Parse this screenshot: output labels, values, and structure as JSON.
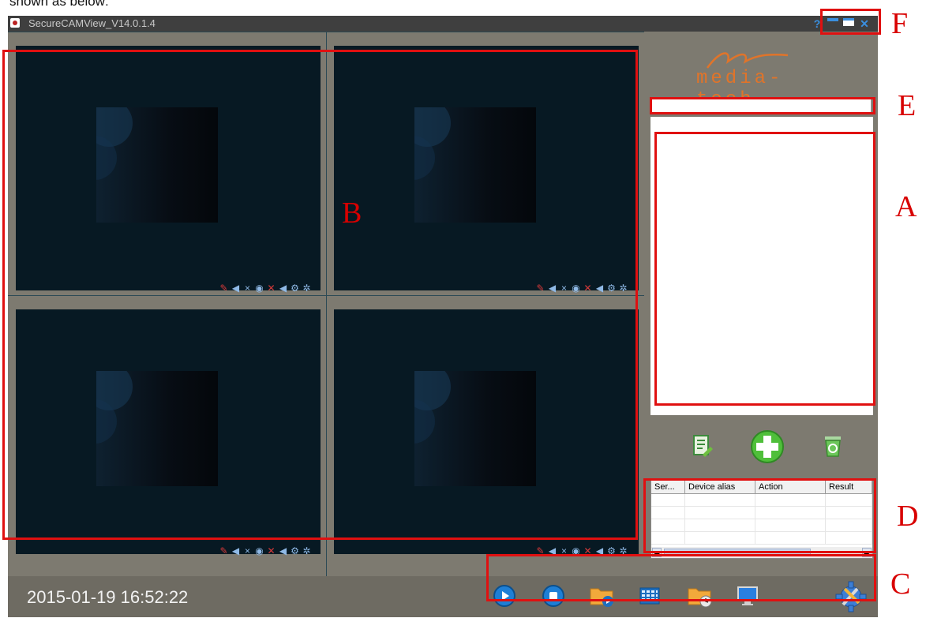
{
  "intro_text": "shown as below:",
  "window": {
    "title": "SecureCAMView_V14.0.1.4"
  },
  "logo_text": "media-tech",
  "pane_controls": [
    "✎",
    "◀",
    "×",
    "◉",
    "✕",
    "◀",
    "⚙",
    "✲"
  ],
  "log_table": {
    "headers": [
      "Ser...",
      "Device alias",
      "Action",
      "Result"
    ]
  },
  "status": {
    "datetime": "2015-01-19 16:52:22"
  },
  "annotations": {
    "A": "A",
    "B": "B",
    "C": "C",
    "D": "D",
    "E": "E",
    "F": "F"
  },
  "icons": {
    "titlebar": [
      "help-icon",
      "minimize-icon",
      "maximize-icon",
      "close-icon"
    ],
    "actions": [
      "edit-device-icon",
      "add-device-icon",
      "delete-device-icon"
    ],
    "toolbar": [
      "play-icon",
      "stop-icon",
      "playback-folder-icon",
      "grid-layout-icon",
      "schedule-folder-icon",
      "monitor-icon",
      "settings-tools-icon"
    ]
  },
  "colors": {
    "annotation_red": "#e01010",
    "video_bg": "#071923",
    "panel_bg": "#7d7a70",
    "accent_blue": "#3a8fe0",
    "logo_orange": "#e0742a"
  }
}
